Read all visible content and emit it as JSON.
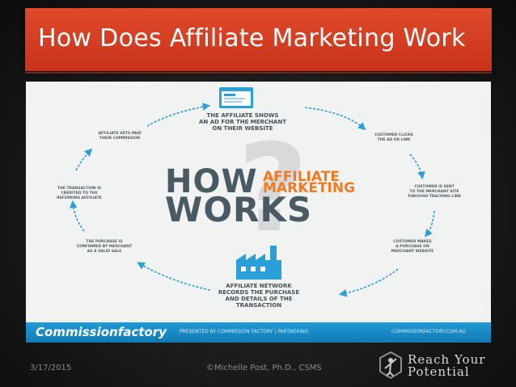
{
  "slide": {
    "title": "How Does Affiliate Marketing Work",
    "date": "3/17/2015",
    "author": "©Michelle Post, Ph.D., CSMS",
    "brand_logo_line1": "Reach Your",
    "brand_logo_line2": "Potential"
  },
  "infographic": {
    "center_how": "HOW",
    "center_works": "WORKS",
    "center_affiliate": "AFFILIATE",
    "center_marketing": "MARKETING",
    "center_mark": "?",
    "steps": {
      "top_l1": "THE AFFILIATE SHOWS",
      "top_l2": "AN AD FOR THE MERCHANT",
      "top_l3": "ON THEIR WEBSITE",
      "r1_l1": "CUSTOMER CLICKS",
      "r1_l2": "THE AD OR LINK",
      "r2_l1": "CUSTOMER IS SENT",
      "r2_l2": "TO THE MERCHANT SITE",
      "r2_l3": "THROUGH TRACKING LINK",
      "r3_l1": "CUSTOMER MAKES",
      "r3_l2": "A PURCHASE ON",
      "r3_l3": "MERCHANT WEBSITE",
      "bottom_l1": "AFFILIATE NETWORK",
      "bottom_l2": "RECORDS THE PURCHASE",
      "bottom_l3": "AND DETAILS OF THE",
      "bottom_l4": "TRANSACTION",
      "l3_l1": "THE PURCHASE IS",
      "l3_l2": "CONFIRMED BY MERCHANT",
      "l3_l3": "AS A VALID SALE",
      "l2_l1": "THE TRANSACTION IS",
      "l2_l2": "CREDITED TO THE",
      "l2_l3": "REFERRING AFFILIATE",
      "l1_l1": "AFFILIATE GETS PAID",
      "l1_l2": "THEIR COMMISSION"
    },
    "footer_logo": "Commissionfactory",
    "footer_mid": "PRESENTED BY COMMISSION FACTORY | PARTNERING",
    "footer_right": "COMMISSIONFACTORY.COM.AU",
    "colors": {
      "accent_orange": "#f47a22",
      "slate": "#4a5a63",
      "blue": "#1f9ad6",
      "title_red": "#d13e22"
    }
  }
}
